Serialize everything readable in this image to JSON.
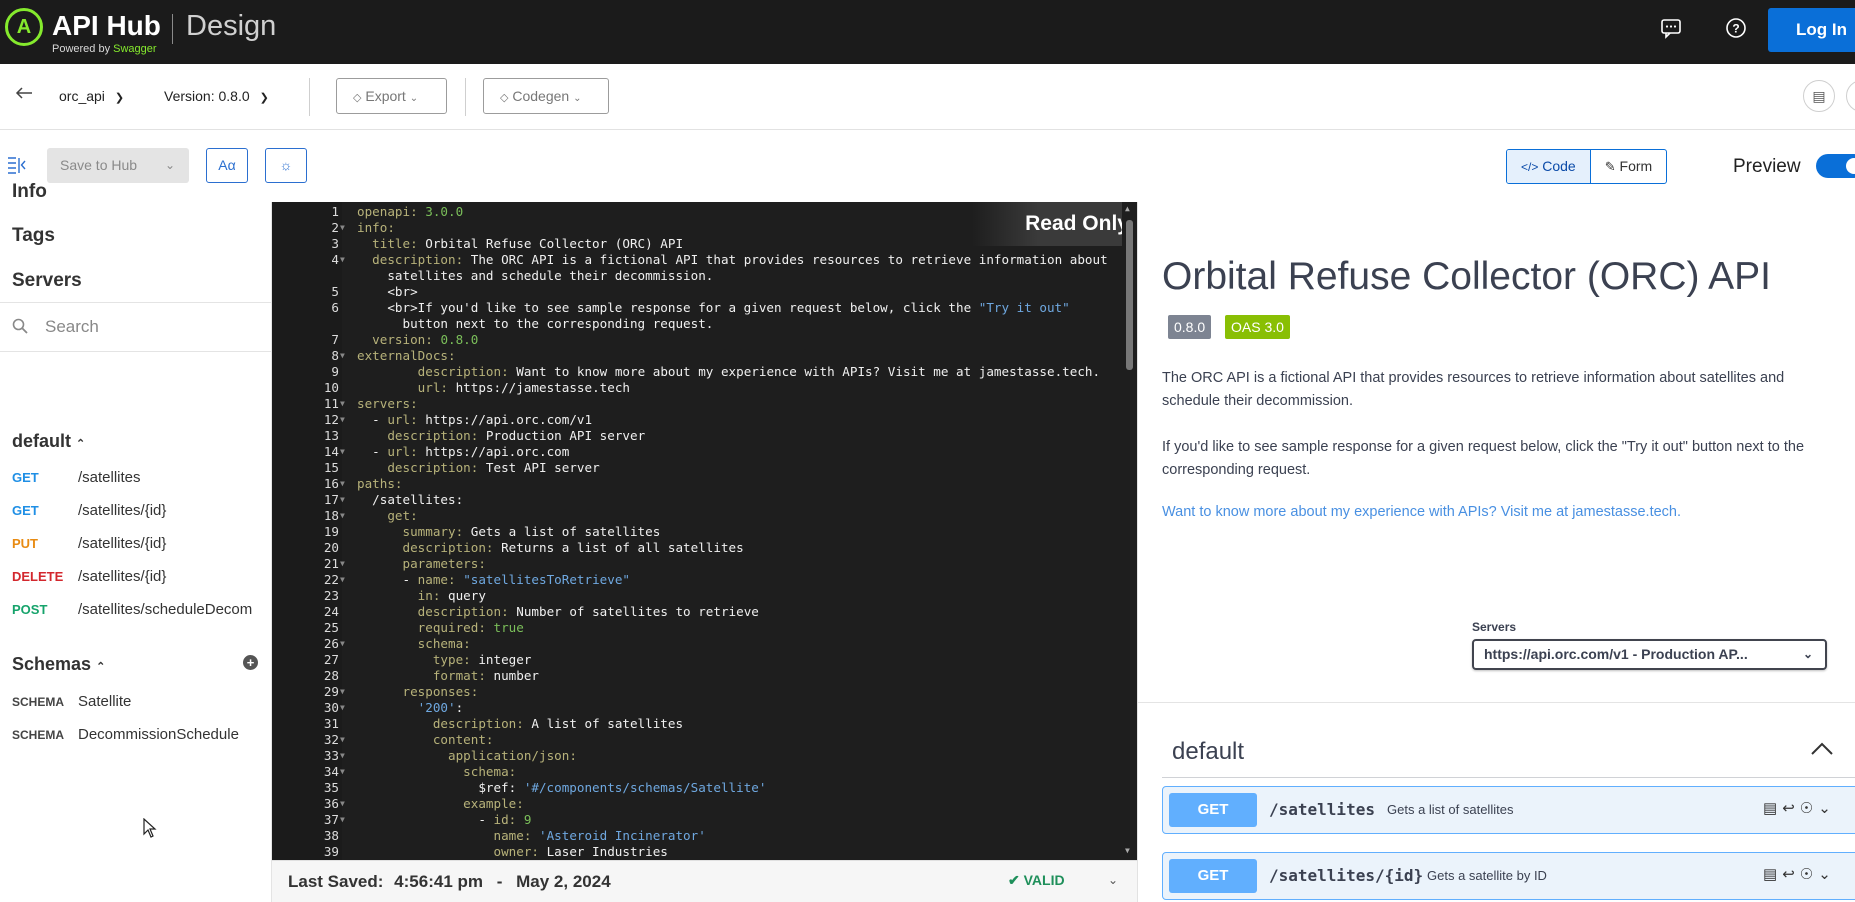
{
  "header": {
    "logo_letter": "A",
    "brand": "API Hub",
    "powered_prefix": "Powered by ",
    "powered_brand": "Swagger",
    "section": "Design",
    "login_label": "Log In"
  },
  "toolbar": {
    "api_name": "orc_api",
    "version_label": "Version: 0.8.0",
    "export_label": "Export",
    "codegen_label": "Codegen",
    "save_to_hub_label": "Save to Hub",
    "font_btn_label": "Aα",
    "code_label": "Code",
    "form_label": "Form",
    "preview_label": "Preview"
  },
  "sidebar": {
    "info": "Info",
    "tags": "Tags",
    "servers": "Servers",
    "search_placeholder": "Search",
    "default_group": "default",
    "operations": [
      {
        "method": "GET",
        "path": "/satellites",
        "color": "#1f8fe5"
      },
      {
        "method": "GET",
        "path": "/satellites/{id}",
        "color": "#1f8fe5"
      },
      {
        "method": "PUT",
        "path": "/satellites/{id}",
        "color": "#e88b12"
      },
      {
        "method": "DELETE",
        "path": "/satellites/{id}",
        "color": "#d3272d"
      },
      {
        "method": "POST",
        "path": "/satellites/scheduleDecom",
        "color": "#16a36b"
      }
    ],
    "schemas_label": "Schemas",
    "schemas": [
      {
        "kind": "SCHEMA",
        "name": "Satellite"
      },
      {
        "kind": "SCHEMA",
        "name": "DecommissionSchedule"
      }
    ]
  },
  "editor": {
    "read_only_label": "Read Only",
    "lines": [
      {
        "n": "1",
        "f": "",
        "t": "<span class=\"k1\">openapi:</span> <span class=\"s1\">3.0.0</span>"
      },
      {
        "n": "2",
        "f": "▼",
        "t": "<span class=\"k1\">info:</span>"
      },
      {
        "n": "3",
        "f": "",
        "t": "  <span class=\"k1\">title:</span> Orbital Refuse Collector (ORC) API"
      },
      {
        "n": "4",
        "f": "▼",
        "t": "  <span class=\"k1\">description:</span> The ORC API is a fictional API that provides resources to retrieve information about"
      },
      {
        "n": "",
        "f": "",
        "t": "    satellites and schedule their decommission."
      },
      {
        "n": "5",
        "f": "",
        "t": "    &lt;br&gt;"
      },
      {
        "n": "6",
        "f": "",
        "t": "    &lt;br&gt;If you'd like to see sample response for a given request below, click the <span class=\"s2\">\"Try it out\"</span>"
      },
      {
        "n": "",
        "f": "",
        "t": "      button next to the corresponding request."
      },
      {
        "n": "7",
        "f": "",
        "t": "  <span class=\"k1\">version:</span> <span class=\"s1\">0.8.0</span>"
      },
      {
        "n": "8",
        "f": "▼",
        "t": "<span class=\"k1\">externalDocs:</span>"
      },
      {
        "n": "9",
        "f": "",
        "t": "        <span class=\"k1\">description:</span> Want to know more about my experience with APIs? Visit me at jamestasse.tech."
      },
      {
        "n": "10",
        "f": "",
        "t": "        <span class=\"k1\">url:</span> https://jamestasse.tech"
      },
      {
        "n": "11",
        "f": "▼",
        "t": "<span class=\"k1\">servers:</span>"
      },
      {
        "n": "12",
        "f": "▼",
        "t": "  - <span class=\"k1\">url:</span> https://api.orc.com/v1"
      },
      {
        "n": "13",
        "f": "",
        "t": "    <span class=\"k1\">description:</span> Production API server"
      },
      {
        "n": "14",
        "f": "▼",
        "t": "  - <span class=\"k1\">url:</span> https://api.orc.com"
      },
      {
        "n": "15",
        "f": "",
        "t": "    <span class=\"k1\">description:</span> Test API server"
      },
      {
        "n": "16",
        "f": "▼",
        "t": "<span class=\"k1\">paths:</span>"
      },
      {
        "n": "17",
        "f": "▼",
        "t": "  /satellites:"
      },
      {
        "n": "18",
        "f": "▼",
        "t": "    <span class=\"k1\">get:</span>"
      },
      {
        "n": "19",
        "f": "",
        "t": "      <span class=\"k1\">summary:</span> Gets a list of satellites"
      },
      {
        "n": "20",
        "f": "",
        "t": "      <span class=\"k1\">description:</span> Returns a list of all satellites"
      },
      {
        "n": "21",
        "f": "▼",
        "t": "      <span class=\"k1\">parameters:</span>"
      },
      {
        "n": "22",
        "f": "▼",
        "t": "      - <span class=\"k1\">name:</span> <span class=\"s2\">\"satellitesToRetrieve\"</span>"
      },
      {
        "n": "23",
        "f": "",
        "t": "        <span class=\"k1\">in:</span> query"
      },
      {
        "n": "24",
        "f": "",
        "t": "        <span class=\"k1\">description:</span> Number of satellites to retrieve"
      },
      {
        "n": "25",
        "f": "",
        "t": "        <span class=\"k1\">required:</span> <span class=\"s1\">true</span>"
      },
      {
        "n": "26",
        "f": "▼",
        "t": "        <span class=\"k1\">schema:</span>"
      },
      {
        "n": "27",
        "f": "",
        "t": "          <span class=\"k1\">type:</span> integer"
      },
      {
        "n": "28",
        "f": "",
        "t": "          <span class=\"k1\">format:</span> number"
      },
      {
        "n": "29",
        "f": "▼",
        "t": "      <span class=\"k1\">responses:</span>"
      },
      {
        "n": "30",
        "f": "▼",
        "t": "        <span class=\"s2\">'200'</span>:"
      },
      {
        "n": "31",
        "f": "",
        "t": "          <span class=\"k1\">description:</span> A list of satellites"
      },
      {
        "n": "32",
        "f": "▼",
        "t": "          <span class=\"k1\">content:</span>"
      },
      {
        "n": "33",
        "f": "▼",
        "t": "            <span class=\"k1\">application/json:</span>"
      },
      {
        "n": "34",
        "f": "▼",
        "t": "              <span class=\"k1\">schema:</span>"
      },
      {
        "n": "35",
        "f": "",
        "t": "                $ref: <span class=\"s2\">'#/components/schemas/Satellite'</span>"
      },
      {
        "n": "36",
        "f": "▼",
        "t": "              <span class=\"k1\">example:</span>"
      },
      {
        "n": "37",
        "f": "▼",
        "t": "                - <span class=\"k1\">id:</span> <span class=\"s1\">9</span>"
      },
      {
        "n": "38",
        "f": "",
        "t": "                  <span class=\"k1\">name:</span> <span class=\"s2\">'Asteroid Incinerator'</span>"
      },
      {
        "n": "39",
        "f": "",
        "t": "                  <span class=\"k1\">owner:</span> Laser Industries"
      }
    ]
  },
  "status": {
    "saved_label": "Last Saved:",
    "saved_time": "4:56:41 pm",
    "saved_sep": "-",
    "saved_date": "May 2, 2024",
    "valid_label": "✔  VALID"
  },
  "doc": {
    "title": "Orbital Refuse Collector (ORC) API",
    "version_badge": "0.8.0",
    "oas_badge": "OAS 3.0",
    "desc1": "The ORC API is a fictional API that provides resources to retrieve information about satellites and schedule their decommission.",
    "desc2": "If you'd like to see sample response for a given request below, click the \"Try it out\" button next to the corresponding request.",
    "link": "Want to know more about my experience with APIs? Visit me at jamestasse.tech.",
    "servers_label": "Servers",
    "servers_value": "https://api.orc.com/v1 - Production AP...",
    "tag": "default",
    "operations": [
      {
        "method": "GET",
        "path": "/satellites",
        "summary": "Gets a list of satellites"
      },
      {
        "method": "GET",
        "path": "/satellites/{id}",
        "summary": "Gets a satellite by ID"
      }
    ]
  }
}
